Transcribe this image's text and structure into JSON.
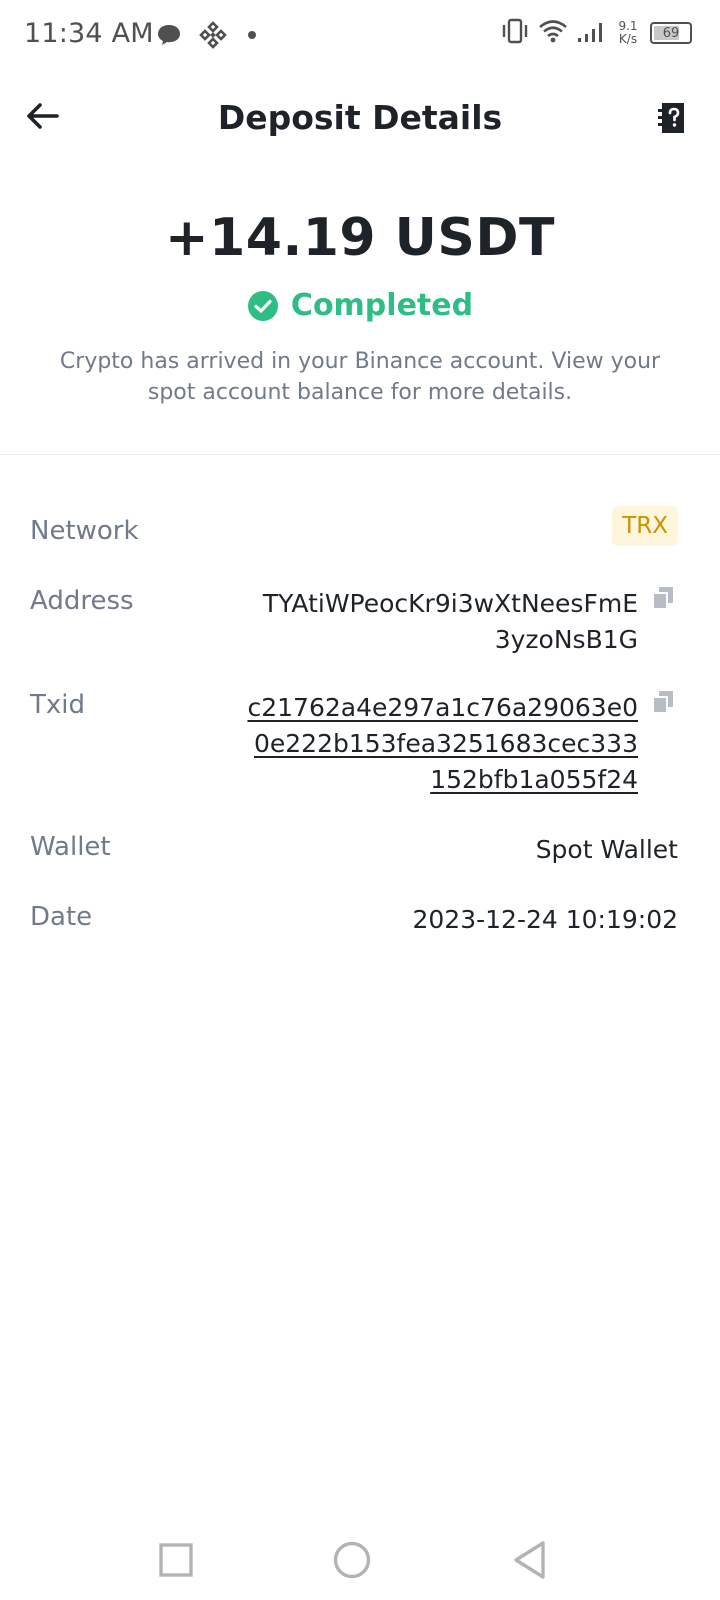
{
  "status_bar": {
    "time": "11:34 AM",
    "net_speed_value": "9.1",
    "net_speed_unit": "K/s",
    "battery": "69",
    "icons": [
      "message-icon",
      "binance-icon",
      "dot-icon",
      "vibrate-icon",
      "wifi-icon",
      "signal-icon",
      "battery-icon"
    ]
  },
  "header": {
    "title": "Deposit Details"
  },
  "summary": {
    "amount": "+14.19 USDT",
    "status": "Completed",
    "description": "Crypto has arrived in your Binance account. View your spot account balance for more details."
  },
  "details": {
    "network": {
      "label": "Network",
      "value": "TRX"
    },
    "address": {
      "label": "Address",
      "value": "TYAtiWPeocKr9i3wXtNeesFmE3yzoNsB1G"
    },
    "txid": {
      "label": "Txid",
      "value": "c21762a4e297a1c76a29063e00e222b153fea3251683cec333152bfb1a055f24"
    },
    "wallet": {
      "label": "Wallet",
      "value": "Spot Wallet"
    },
    "date": {
      "label": "Date",
      "value": "2023-12-24 10:19:02"
    }
  },
  "colors": {
    "success": "#2ebd85",
    "tag_bg": "#fdf6dc",
    "tag_text": "#c99400",
    "muted": "#707a8a",
    "primary_text": "#1e2329"
  }
}
